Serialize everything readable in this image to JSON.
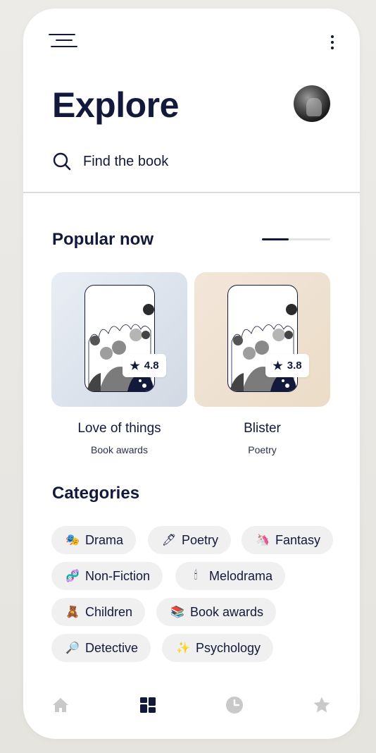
{
  "header": {
    "title": "Explore"
  },
  "search": {
    "placeholder": "Find the book"
  },
  "popular": {
    "title": "Popular now",
    "books": [
      {
        "title": "Love of things",
        "category": "Book awards",
        "rating": "4.8"
      },
      {
        "title": "Blister",
        "category": "Poetry",
        "rating": "3.8"
      }
    ]
  },
  "categories": {
    "title": "Categories",
    "items": [
      {
        "label": "Drama",
        "emoji": "🎭"
      },
      {
        "label": "Poetry",
        "emoji": "🖊"
      },
      {
        "label": "Fantasy",
        "emoji": "🦄"
      },
      {
        "label": "Non-Fiction",
        "emoji": "🧬"
      },
      {
        "label": "Melodrama",
        "emoji": "🕯"
      },
      {
        "label": "Children",
        "emoji": "🧸"
      },
      {
        "label": "Book awards",
        "emoji": "📚"
      },
      {
        "label": "Detective",
        "emoji": "🔎"
      },
      {
        "label": "Psychology",
        "emoji": "✨"
      }
    ]
  },
  "nav": {
    "tabs": [
      {
        "icon": "home-icon",
        "active": false
      },
      {
        "icon": "grid-icon",
        "active": true
      },
      {
        "icon": "clock-icon",
        "active": false
      },
      {
        "icon": "star-icon",
        "active": false
      }
    ]
  },
  "colors": {
    "primary": "#13193a",
    "muted": "#c9c9c9",
    "chip_bg": "#f0f0f0"
  }
}
